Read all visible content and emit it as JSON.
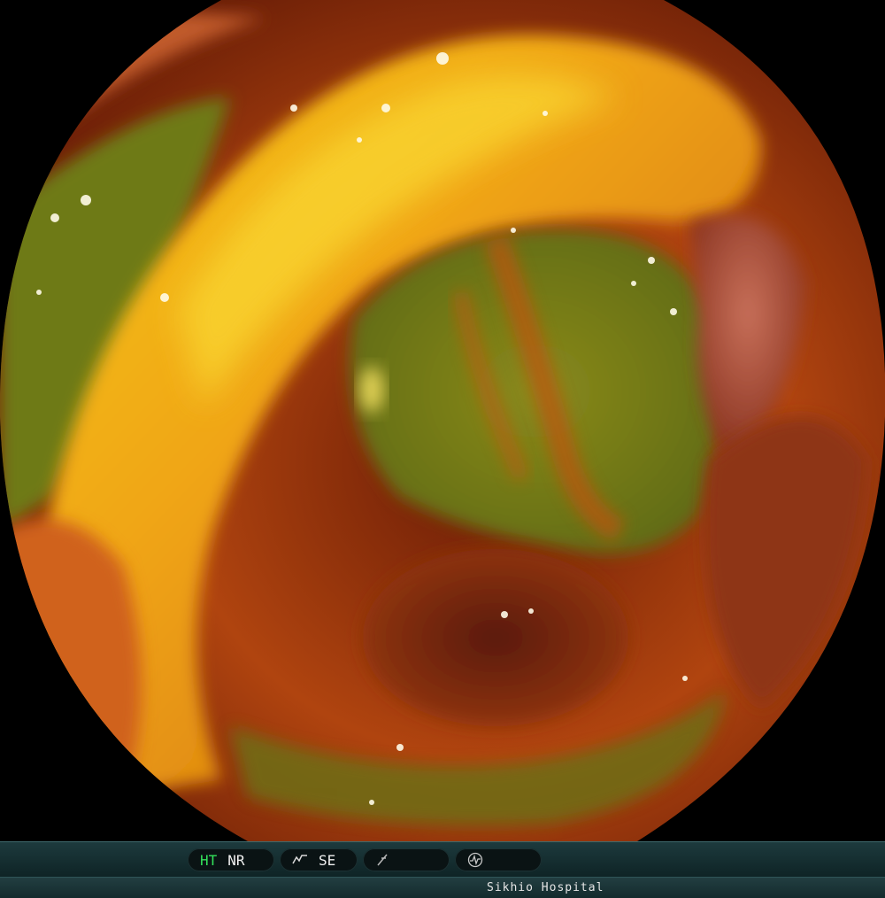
{
  "status_bar": {
    "ht_label": "HT",
    "nr_label": "NR",
    "se_label": "SE",
    "ht_color": "#33e05a",
    "icons": [
      "enhancement-curve-icon",
      "freeze-icon",
      "waveform-icon"
    ]
  },
  "info_bar": {
    "hospital": "Sikhio Hospital"
  }
}
